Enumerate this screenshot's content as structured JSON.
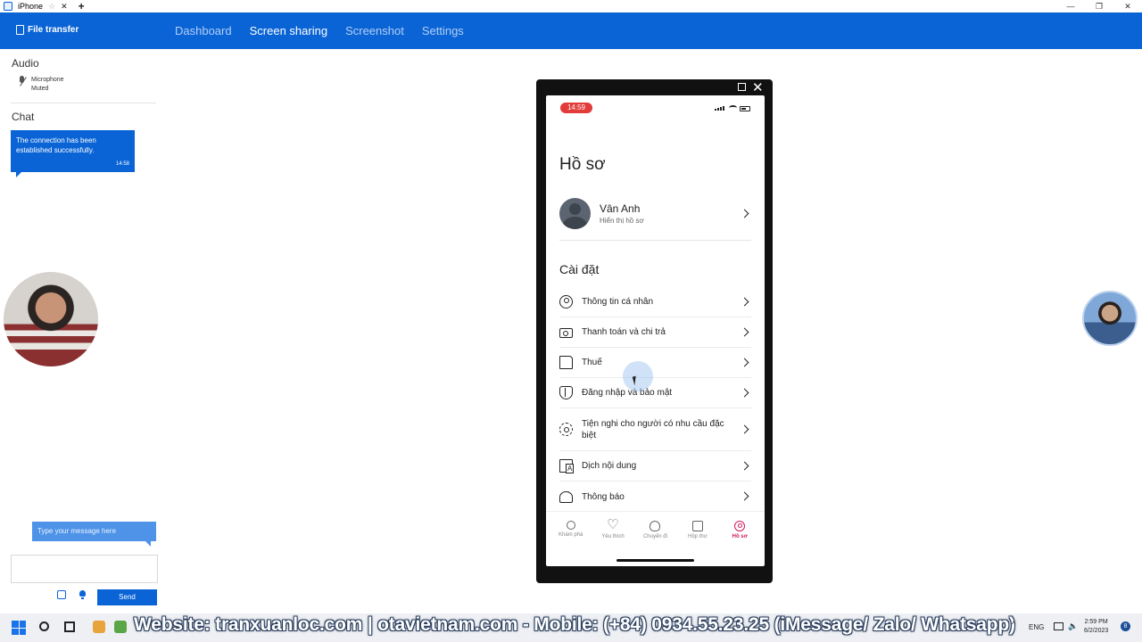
{
  "titlebar": {
    "tab_title": "iPhone",
    "close_glyph": "✕",
    "new_tab_glyph": "+",
    "controls": [
      "—",
      "❐",
      "✕"
    ]
  },
  "topnav": {
    "file_transfer": "File transfer",
    "links": [
      "Dashboard",
      "Screen sharing",
      "Screenshot",
      "Settings"
    ],
    "active": "Screen sharing",
    "accent": "#0a64d6"
  },
  "left": {
    "audio_heading": "Audio",
    "mic_label": "Microphone",
    "mic_status": "Muted",
    "chat_heading": "Chat",
    "chat_message": "The connection has been established successfully.",
    "chat_time": "14:58",
    "input_placeholder": "Type your message here",
    "send_label": "Send"
  },
  "phone": {
    "status_time": "14:59",
    "title": "Hồ sơ",
    "profile_name": "Vân Anh",
    "profile_sub": "Hiển thị hồ sơ",
    "settings_heading": "Cài đặt",
    "menu": [
      {
        "label": "Thông tin cá nhân",
        "icon": "user-circle-icon"
      },
      {
        "label": "Thanh toán và chi trả",
        "icon": "payment-card-icon"
      },
      {
        "label": "Thuế",
        "icon": "document-icon"
      },
      {
        "label": "Đăng nhập và bảo mật",
        "icon": "shield-icon"
      },
      {
        "label": "Tiện nghi cho người có nhu cầu đặc biệt",
        "icon": "gear-icon"
      },
      {
        "label": "Dịch nội dung",
        "icon": "translate-icon"
      },
      {
        "label": "Thông báo",
        "icon": "bell-icon"
      }
    ],
    "tabs": [
      {
        "label": "Khám phá",
        "icon": "search-icon"
      },
      {
        "label": "Yêu thích",
        "icon": "heart-icon"
      },
      {
        "label": "Chuyến đi",
        "icon": "airbnb-icon"
      },
      {
        "label": "Hộp thư",
        "icon": "inbox-icon"
      },
      {
        "label": "Hồ sơ",
        "icon": "profile-icon"
      }
    ],
    "active_tab": "Hồ sơ",
    "brand_color": "#d1185b"
  },
  "taskbar": {
    "banner": "Website: tranxuanloc.com | otavietnam.com - Mobile: (+84) 0934.55.23.25 (iMessage/ Zalo/ Whatsapp)",
    "tray_up": "^",
    "lang": "ENG",
    "time": "2:59 PM",
    "date": "6/2/2023",
    "badge": "8"
  }
}
